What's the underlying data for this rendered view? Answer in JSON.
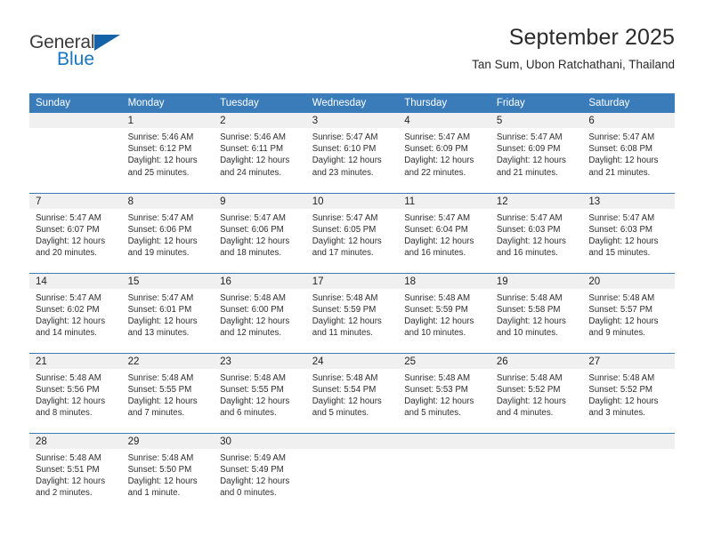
{
  "logo": {
    "word_top": "General",
    "word_bottom": "Blue",
    "triangle": "blue-triangle-icon",
    "color_dark": "#3c3c3c",
    "color_blue": "#1775c4"
  },
  "header": {
    "title": "September 2025",
    "subtitle": "Tan Sum, Ubon Ratchathani, Thailand"
  },
  "theme": {
    "header_blue": "#3a7cb9",
    "daynum_band": "#f0f0f0",
    "text": "#2e2e2e"
  },
  "calendar": {
    "weekday_headers": [
      "Sunday",
      "Monday",
      "Tuesday",
      "Wednesday",
      "Thursday",
      "Friday",
      "Saturday"
    ],
    "weeks": [
      [
        {
          "day": "",
          "sunrise": "",
          "sunset": "",
          "daylight_1": "",
          "daylight_2": "",
          "empty": true
        },
        {
          "day": "1",
          "sunrise": "Sunrise: 5:46 AM",
          "sunset": "Sunset: 6:12 PM",
          "daylight_1": "Daylight: 12 hours",
          "daylight_2": "and 25 minutes."
        },
        {
          "day": "2",
          "sunrise": "Sunrise: 5:46 AM",
          "sunset": "Sunset: 6:11 PM",
          "daylight_1": "Daylight: 12 hours",
          "daylight_2": "and 24 minutes."
        },
        {
          "day": "3",
          "sunrise": "Sunrise: 5:47 AM",
          "sunset": "Sunset: 6:10 PM",
          "daylight_1": "Daylight: 12 hours",
          "daylight_2": "and 23 minutes."
        },
        {
          "day": "4",
          "sunrise": "Sunrise: 5:47 AM",
          "sunset": "Sunset: 6:09 PM",
          "daylight_1": "Daylight: 12 hours",
          "daylight_2": "and 22 minutes."
        },
        {
          "day": "5",
          "sunrise": "Sunrise: 5:47 AM",
          "sunset": "Sunset: 6:09 PM",
          "daylight_1": "Daylight: 12 hours",
          "daylight_2": "and 21 minutes."
        },
        {
          "day": "6",
          "sunrise": "Sunrise: 5:47 AM",
          "sunset": "Sunset: 6:08 PM",
          "daylight_1": "Daylight: 12 hours",
          "daylight_2": "and 21 minutes."
        }
      ],
      [
        {
          "day": "7",
          "sunrise": "Sunrise: 5:47 AM",
          "sunset": "Sunset: 6:07 PM",
          "daylight_1": "Daylight: 12 hours",
          "daylight_2": "and 20 minutes."
        },
        {
          "day": "8",
          "sunrise": "Sunrise: 5:47 AM",
          "sunset": "Sunset: 6:06 PM",
          "daylight_1": "Daylight: 12 hours",
          "daylight_2": "and 19 minutes."
        },
        {
          "day": "9",
          "sunrise": "Sunrise: 5:47 AM",
          "sunset": "Sunset: 6:06 PM",
          "daylight_1": "Daylight: 12 hours",
          "daylight_2": "and 18 minutes."
        },
        {
          "day": "10",
          "sunrise": "Sunrise: 5:47 AM",
          "sunset": "Sunset: 6:05 PM",
          "daylight_1": "Daylight: 12 hours",
          "daylight_2": "and 17 minutes."
        },
        {
          "day": "11",
          "sunrise": "Sunrise: 5:47 AM",
          "sunset": "Sunset: 6:04 PM",
          "daylight_1": "Daylight: 12 hours",
          "daylight_2": "and 16 minutes."
        },
        {
          "day": "12",
          "sunrise": "Sunrise: 5:47 AM",
          "sunset": "Sunset: 6:03 PM",
          "daylight_1": "Daylight: 12 hours",
          "daylight_2": "and 16 minutes."
        },
        {
          "day": "13",
          "sunrise": "Sunrise: 5:47 AM",
          "sunset": "Sunset: 6:03 PM",
          "daylight_1": "Daylight: 12 hours",
          "daylight_2": "and 15 minutes."
        }
      ],
      [
        {
          "day": "14",
          "sunrise": "Sunrise: 5:47 AM",
          "sunset": "Sunset: 6:02 PM",
          "daylight_1": "Daylight: 12 hours",
          "daylight_2": "and 14 minutes."
        },
        {
          "day": "15",
          "sunrise": "Sunrise: 5:47 AM",
          "sunset": "Sunset: 6:01 PM",
          "daylight_1": "Daylight: 12 hours",
          "daylight_2": "and 13 minutes."
        },
        {
          "day": "16",
          "sunrise": "Sunrise: 5:48 AM",
          "sunset": "Sunset: 6:00 PM",
          "daylight_1": "Daylight: 12 hours",
          "daylight_2": "and 12 minutes."
        },
        {
          "day": "17",
          "sunrise": "Sunrise: 5:48 AM",
          "sunset": "Sunset: 5:59 PM",
          "daylight_1": "Daylight: 12 hours",
          "daylight_2": "and 11 minutes."
        },
        {
          "day": "18",
          "sunrise": "Sunrise: 5:48 AM",
          "sunset": "Sunset: 5:59 PM",
          "daylight_1": "Daylight: 12 hours",
          "daylight_2": "and 10 minutes."
        },
        {
          "day": "19",
          "sunrise": "Sunrise: 5:48 AM",
          "sunset": "Sunset: 5:58 PM",
          "daylight_1": "Daylight: 12 hours",
          "daylight_2": "and 10 minutes."
        },
        {
          "day": "20",
          "sunrise": "Sunrise: 5:48 AM",
          "sunset": "Sunset: 5:57 PM",
          "daylight_1": "Daylight: 12 hours",
          "daylight_2": "and 9 minutes."
        }
      ],
      [
        {
          "day": "21",
          "sunrise": "Sunrise: 5:48 AM",
          "sunset": "Sunset: 5:56 PM",
          "daylight_1": "Daylight: 12 hours",
          "daylight_2": "and 8 minutes."
        },
        {
          "day": "22",
          "sunrise": "Sunrise: 5:48 AM",
          "sunset": "Sunset: 5:55 PM",
          "daylight_1": "Daylight: 12 hours",
          "daylight_2": "and 7 minutes."
        },
        {
          "day": "23",
          "sunrise": "Sunrise: 5:48 AM",
          "sunset": "Sunset: 5:55 PM",
          "daylight_1": "Daylight: 12 hours",
          "daylight_2": "and 6 minutes."
        },
        {
          "day": "24",
          "sunrise": "Sunrise: 5:48 AM",
          "sunset": "Sunset: 5:54 PM",
          "daylight_1": "Daylight: 12 hours",
          "daylight_2": "and 5 minutes."
        },
        {
          "day": "25",
          "sunrise": "Sunrise: 5:48 AM",
          "sunset": "Sunset: 5:53 PM",
          "daylight_1": "Daylight: 12 hours",
          "daylight_2": "and 5 minutes."
        },
        {
          "day": "26",
          "sunrise": "Sunrise: 5:48 AM",
          "sunset": "Sunset: 5:52 PM",
          "daylight_1": "Daylight: 12 hours",
          "daylight_2": "and 4 minutes."
        },
        {
          "day": "27",
          "sunrise": "Sunrise: 5:48 AM",
          "sunset": "Sunset: 5:52 PM",
          "daylight_1": "Daylight: 12 hours",
          "daylight_2": "and 3 minutes."
        }
      ],
      [
        {
          "day": "28",
          "sunrise": "Sunrise: 5:48 AM",
          "sunset": "Sunset: 5:51 PM",
          "daylight_1": "Daylight: 12 hours",
          "daylight_2": "and 2 minutes."
        },
        {
          "day": "29",
          "sunrise": "Sunrise: 5:48 AM",
          "sunset": "Sunset: 5:50 PM",
          "daylight_1": "Daylight: 12 hours",
          "daylight_2": "and 1 minute."
        },
        {
          "day": "30",
          "sunrise": "Sunrise: 5:49 AM",
          "sunset": "Sunset: 5:49 PM",
          "daylight_1": "Daylight: 12 hours",
          "daylight_2": "and 0 minutes."
        },
        {
          "day": "",
          "sunrise": "",
          "sunset": "",
          "daylight_1": "",
          "daylight_2": "",
          "empty": true
        },
        {
          "day": "",
          "sunrise": "",
          "sunset": "",
          "daylight_1": "",
          "daylight_2": "",
          "empty": true
        },
        {
          "day": "",
          "sunrise": "",
          "sunset": "",
          "daylight_1": "",
          "daylight_2": "",
          "empty": true
        },
        {
          "day": "",
          "sunrise": "",
          "sunset": "",
          "daylight_1": "",
          "daylight_2": "",
          "empty": true
        }
      ]
    ]
  }
}
